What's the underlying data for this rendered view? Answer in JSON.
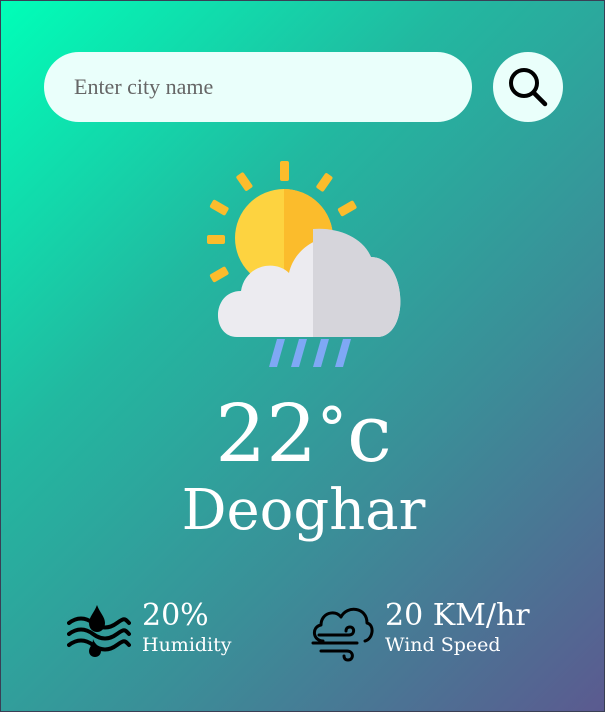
{
  "search": {
    "placeholder": "Enter city name",
    "value": ""
  },
  "icons": {
    "search": "search-icon",
    "weather": "partly-cloudy-rain-icon",
    "humidity": "humidity-icon",
    "wind": "wind-icon"
  },
  "weather": {
    "temperature": "22",
    "unit": "c",
    "city": "Deoghar"
  },
  "stats": {
    "humidity": {
      "value": "20%",
      "label": "Humidity"
    },
    "wind": {
      "value": "20 KM/hr",
      "label": "Wind Speed"
    }
  },
  "colors": {
    "gradient_start": "#00ffb8",
    "gradient_end": "#5b5a90",
    "search_background": "#eafffb",
    "sun": "#fdd340",
    "sun_rays": "#fbbc2c",
    "cloud": "#ecebf0",
    "rain": "#7fa8f5"
  }
}
